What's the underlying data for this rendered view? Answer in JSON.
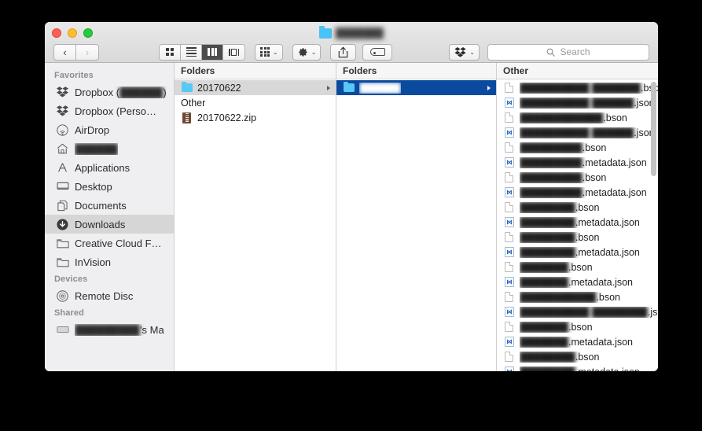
{
  "window": {
    "title": "███████",
    "title_icon": "folder-icon",
    "traffic_lights": {
      "close": "close",
      "minimize": "minimize",
      "zoom": "zoom"
    }
  },
  "toolbar": {
    "back_label": "‹",
    "forward_label": "›",
    "view_modes": [
      {
        "name": "icon-view",
        "label": "Icon view",
        "active": false
      },
      {
        "name": "list-view",
        "label": "List view",
        "active": false
      },
      {
        "name": "column-view",
        "label": "Column view",
        "active": true
      },
      {
        "name": "gallery-view",
        "label": "Gallery view",
        "active": false
      }
    ],
    "arrange_label": "",
    "action_label": "",
    "share_label": "",
    "tags_label": "",
    "dropbox_label": "",
    "caret": "⌄"
  },
  "search": {
    "placeholder": "Search",
    "value": "",
    "icon": "search-icon"
  },
  "sidebar": {
    "sections": [
      {
        "header": "Favorites",
        "items": [
          {
            "icon": "dropbox-icon",
            "label": "Dropbox (",
            "blur_label": "██████",
            "label_tail": ")",
            "selected": false
          },
          {
            "icon": "dropbox-icon",
            "label": "Dropbox (Perso…",
            "selected": false
          },
          {
            "icon": "airdrop-icon",
            "label": "AirDrop",
            "selected": false
          },
          {
            "icon": "home-icon",
            "label": "",
            "blur_label": "██████",
            "selected": false
          },
          {
            "icon": "applications-icon",
            "label": "Applications",
            "selected": false
          },
          {
            "icon": "desktop-icon",
            "label": "Desktop",
            "selected": false
          },
          {
            "icon": "documents-icon",
            "label": "Documents",
            "selected": false
          },
          {
            "icon": "downloads-icon",
            "label": "Downloads",
            "selected": true
          },
          {
            "icon": "folder-icon",
            "label": "Creative Cloud F…",
            "selected": false
          },
          {
            "icon": "folder-icon",
            "label": "InVision",
            "selected": false
          }
        ]
      },
      {
        "header": "Devices",
        "items": [
          {
            "icon": "disc-icon",
            "label": "Remote Disc",
            "selected": false
          }
        ]
      },
      {
        "header": "Shared",
        "items": [
          {
            "icon": "server-icon",
            "label": "",
            "blur_label": "█████████",
            "label_tail": "’s Ma",
            "selected": false
          }
        ]
      }
    ]
  },
  "columns": [
    {
      "name": "column-1",
      "header": "Folders",
      "rows": [
        {
          "icon": "folder-icon",
          "name": "20170622",
          "selected": "gray",
          "disclosure": true
        },
        {
          "type": "group-header",
          "name": "Other"
        },
        {
          "icon": "zip-icon",
          "name": "20170622.zip",
          "selected": "none",
          "disclosure": false
        }
      ]
    },
    {
      "name": "column-2",
      "header": "Folders",
      "rows": [
        {
          "icon": "folder-icon",
          "name": "",
          "blur_name": "██████",
          "selected": "blue",
          "disclosure": true
        }
      ]
    },
    {
      "name": "column-3",
      "header": "Other",
      "rows": [
        {
          "icon": "doc-icon",
          "blur_name": "██████████ ███████",
          "name": ".bson"
        },
        {
          "icon": "json-icon",
          "blur_name": "██████████ ██████",
          "name": ".json"
        },
        {
          "icon": "doc-ico",
          "blur_name": "████████████",
          "name": ".bson"
        },
        {
          "icon": "json-icon",
          "blur_name": "██████████ ██████",
          "name": ".json"
        },
        {
          "icon": "doc-icon",
          "blur_name": "█████████",
          "name": ".bson"
        },
        {
          "icon": "json-icon",
          "blur_name": "█████████",
          "name": ".metadata.json"
        },
        {
          "icon": "doc-icon",
          "blur_name": "█████████",
          "name": ".bson"
        },
        {
          "icon": "json-icon",
          "blur_name": "█████████",
          "name": ".metadata.json"
        },
        {
          "icon": "doc-icon",
          "blur_name": "████████",
          "name": ".bson"
        },
        {
          "icon": "json-icon",
          "blur_name": "████████",
          "name": ".metadata.json"
        },
        {
          "icon": "doc-icon",
          "blur_name": "████████",
          "name": ".bson"
        },
        {
          "icon": "json-icon",
          "blur_name": "████████",
          "name": ".metadata.json"
        },
        {
          "icon": "doc-icon",
          "blur_name": "███████",
          "name": ".bson"
        },
        {
          "icon": "json-icon",
          "blur_name": "███████",
          "name": ".metadata.json"
        },
        {
          "icon": "doc-icon",
          "blur_name": "███████████",
          "name": ".bson"
        },
        {
          "icon": "json-icon",
          "blur_name": "██████████ ████████",
          "name": ".json"
        },
        {
          "icon": "doc-icon",
          "blur_name": "███████",
          "name": ".bson"
        },
        {
          "icon": "json-icon",
          "blur_name": "███████",
          "name": ".metadata.json"
        },
        {
          "icon": "doc-icon",
          "blur_name": "████████",
          "name": ".bson"
        },
        {
          "icon": "json-icon",
          "blur_name": "████████",
          "name": ".metadata.json"
        }
      ]
    }
  ]
}
